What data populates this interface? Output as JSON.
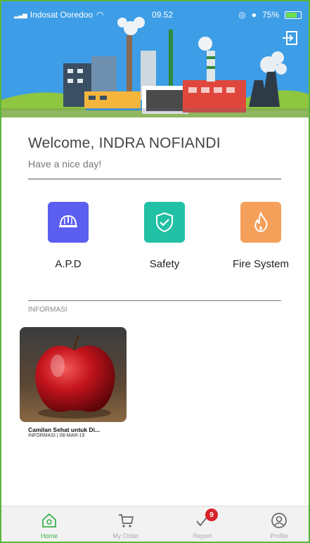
{
  "status_bar": {
    "carrier": "Indosat Ooredoo",
    "time": "09.52",
    "battery": "75%"
  },
  "header": {
    "logout_icon": "logout-icon",
    "illustration": "industrial-factory-illustration"
  },
  "welcome": {
    "greeting": "Welcome, INDRA NOFIANDI",
    "tagline": "Have a nice day!"
  },
  "menu": [
    {
      "label": "A.P.D",
      "icon": "helmet-icon",
      "color": "#5b5ef0"
    },
    {
      "label": "Safety",
      "icon": "shield-check-icon",
      "color": "#22c0a4"
    },
    {
      "label": "Fire System",
      "icon": "flame-icon",
      "color": "#f5a05a"
    }
  ],
  "informasi": {
    "section_label": "INFORMASI",
    "cards": [
      {
        "title": "Camilan Sehat untuk Di...",
        "meta": "INFORMASI | 08-MAR-19",
        "image": "red-apple-photo"
      }
    ]
  },
  "tabs": [
    {
      "label": "Home",
      "icon": "home-icon",
      "active": true
    },
    {
      "label": "My Order",
      "icon": "cart-icon",
      "active": false
    },
    {
      "label": "Report",
      "icon": "checkmark-icon",
      "active": false,
      "badge": "9"
    },
    {
      "label": "Profile",
      "icon": "user-circle-icon",
      "active": false
    }
  ],
  "colors": {
    "header_bg": "#3d9de6",
    "frame": "#5cb53a",
    "tab_active": "#3cb14a",
    "badge": "#d6232a"
  }
}
